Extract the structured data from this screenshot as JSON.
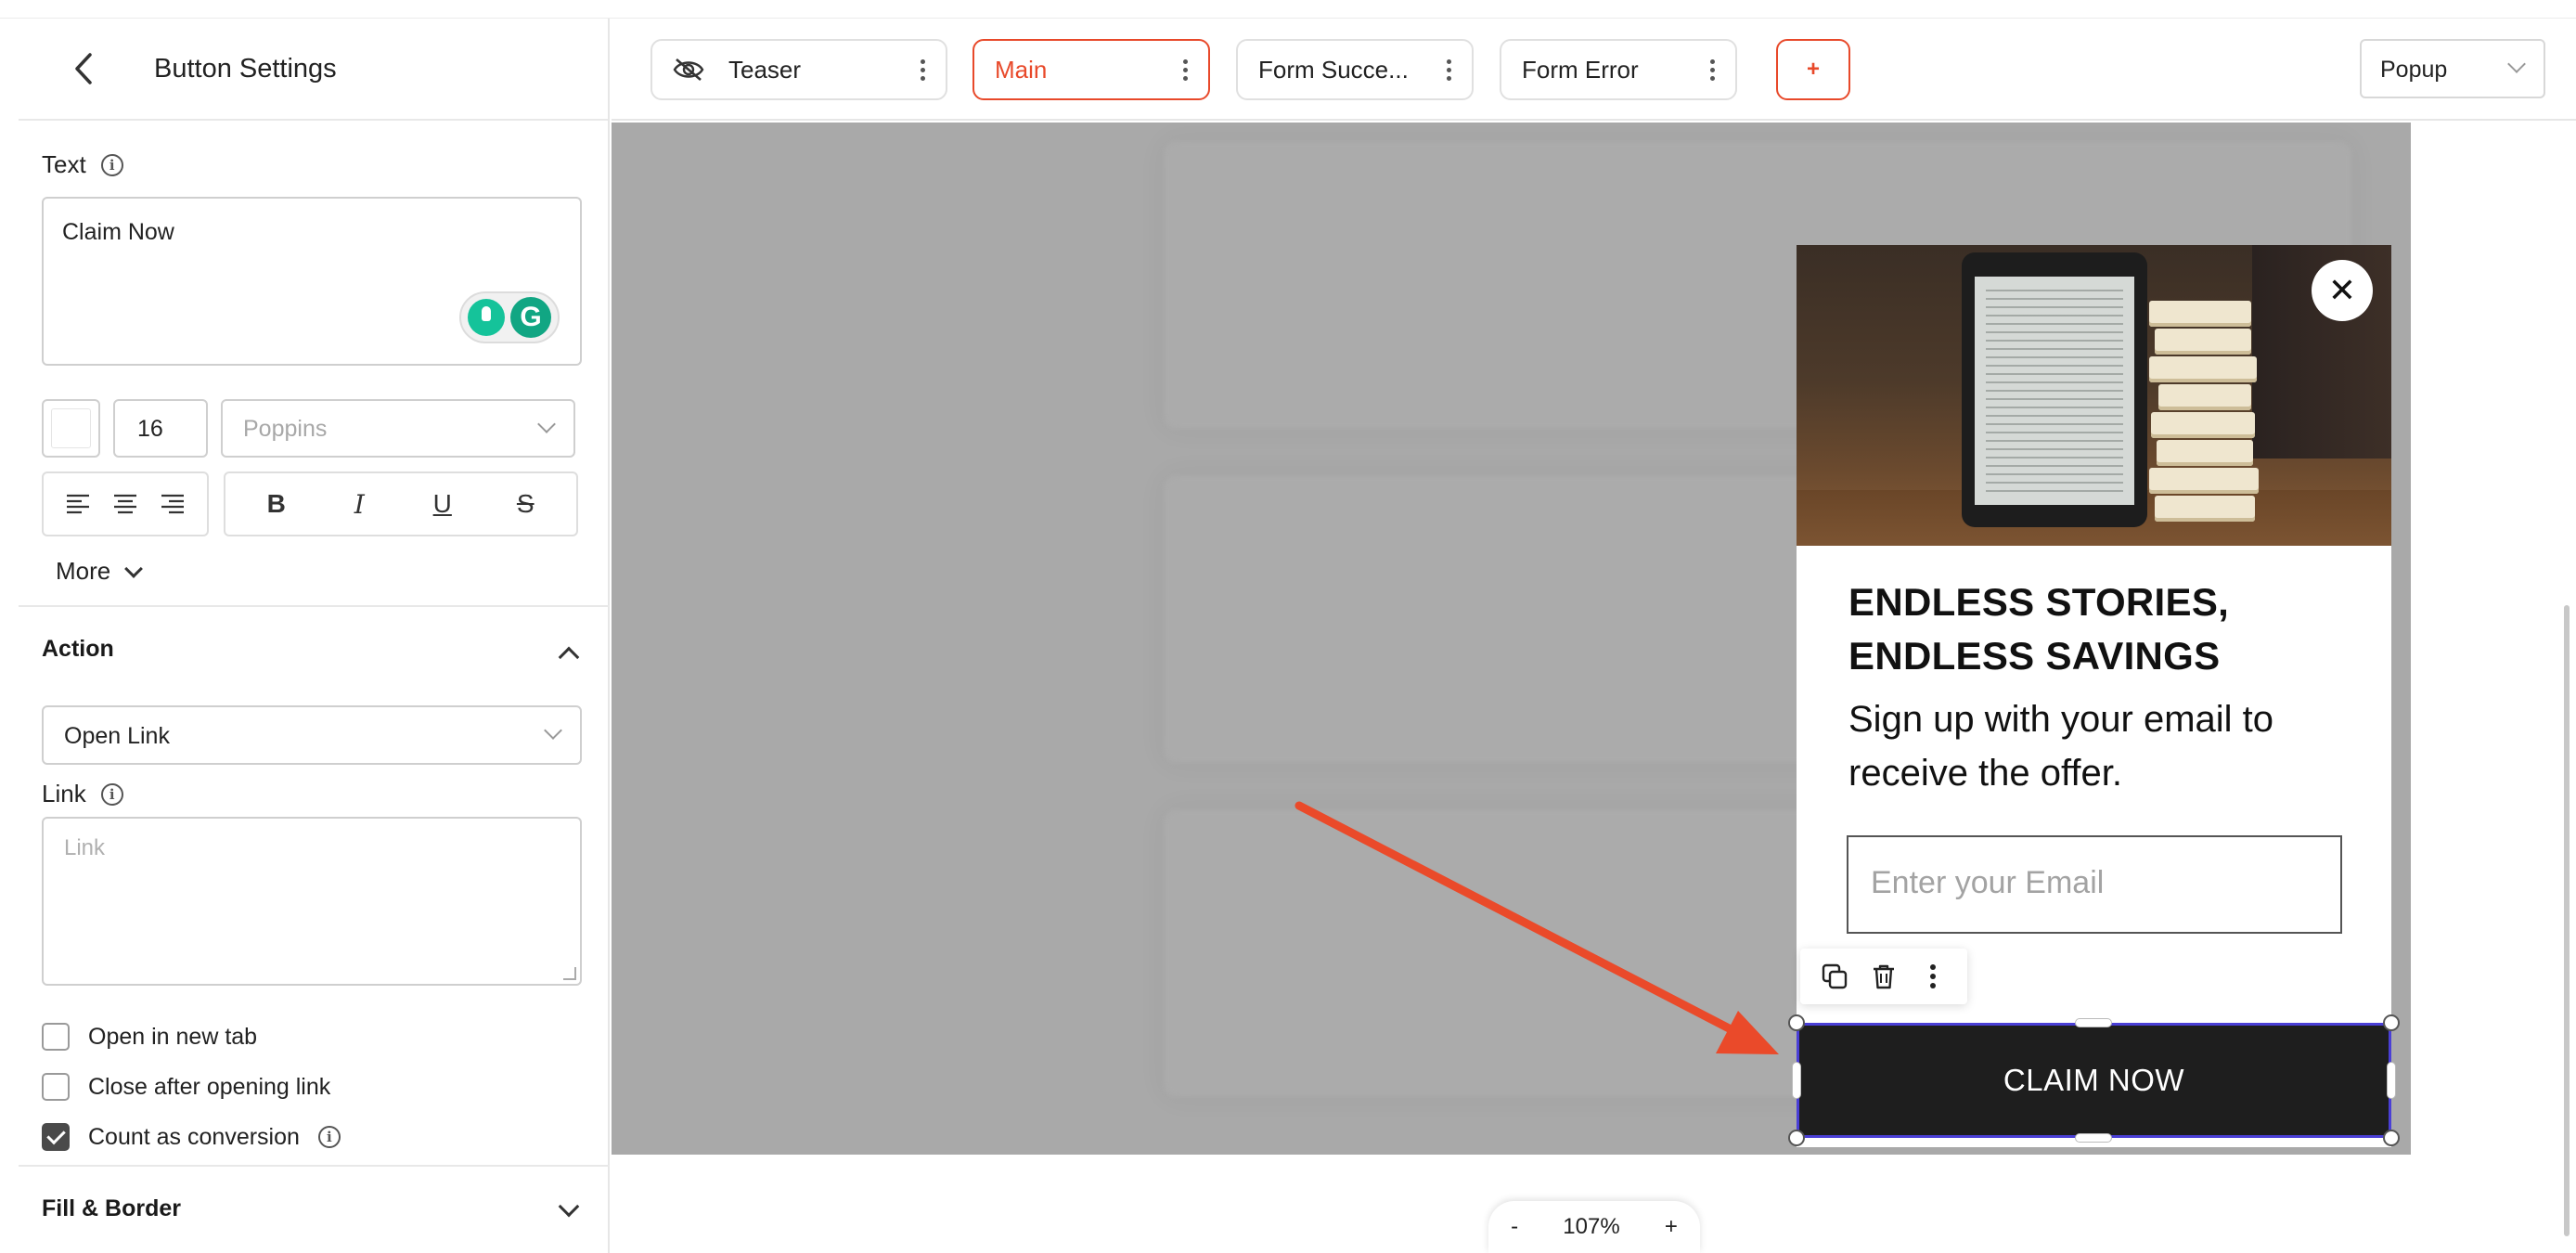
{
  "panel": {
    "title": "Button Settings",
    "text_label": "Text",
    "text_value": "Claim Now",
    "font_size": "16",
    "font_family_placeholder": "Poppins",
    "more_label": "More",
    "action_section": "Action",
    "action_value": "Open Link",
    "link_label": "Link",
    "link_placeholder": "Link",
    "checkboxes": [
      {
        "label": "Open in new tab",
        "checked": false
      },
      {
        "label": "Close after opening link",
        "checked": false
      },
      {
        "label": "Count as conversion",
        "checked": true
      }
    ],
    "fill_border_section": "Fill & Border",
    "format_buttons": [
      "B",
      "I",
      "U",
      "S"
    ]
  },
  "tabs": [
    {
      "label": "Teaser",
      "active": false,
      "hidden_icon": "eye-off-icon"
    },
    {
      "label": "Main",
      "active": true
    },
    {
      "label": "Form Succe...",
      "active": false
    },
    {
      "label": "Form Error",
      "active": false
    }
  ],
  "add_tab_label": "+",
  "view_select": "Popup",
  "popup": {
    "heading": "ENDLESS STORIES, ENDLESS SAVINGS",
    "subheading": "Sign up with your email to receive the offer.",
    "email_placeholder": "Enter your Email",
    "button_text": "CLAIM NOW",
    "close_symbol": "✕"
  },
  "zoom": {
    "minus": "-",
    "level": "107%",
    "plus": "+"
  },
  "colors": {
    "accent": "#e8492a",
    "selection": "#4a3fd6",
    "button_bg": "#1e1e1e",
    "canvas_bg": "#a9a9a9"
  }
}
